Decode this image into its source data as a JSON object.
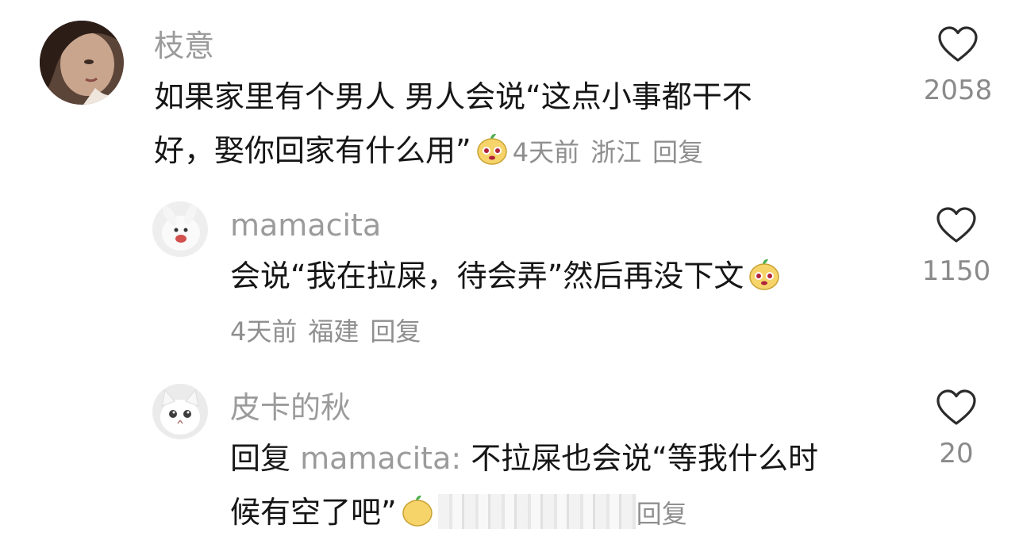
{
  "comments": [
    {
      "username": "枝意",
      "lines": [
        "如果家里有个男人 男人会说“这点小事都干不",
        "好，娶你回家有什么用”"
      ],
      "emoji": "pear-face-emoji",
      "time": "4天前",
      "location": "浙江",
      "reply_label": "回复",
      "likes": "2058"
    },
    {
      "username": "mamacita",
      "lines": [
        "会说“我在拉屎，待会弄”然后再没下文"
      ],
      "emoji": "pear-face-emoji",
      "time": "4天前",
      "location": "福建",
      "reply_label": "回复",
      "likes": "1150"
    },
    {
      "username": "皮卡的秋",
      "reply_prefix": "回复",
      "reply_target": "mamacita:",
      "lines": [
        "不拉屎也会说“等我什么时",
        "候有空了吧”"
      ],
      "emoji": "pear-face-emoji",
      "reply_label": "回复",
      "likes": "20"
    }
  ],
  "colors": {
    "username": "#9b9b9b",
    "meta": "#8f8f8f",
    "text": "#161616",
    "heart": "#2b2b2b"
  }
}
